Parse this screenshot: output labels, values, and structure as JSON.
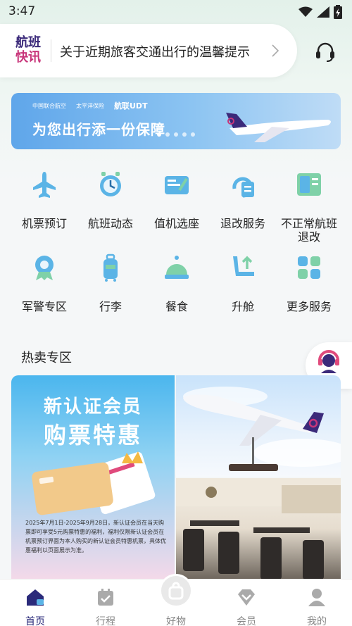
{
  "status_bar": {
    "time": "3:47"
  },
  "notice": {
    "logo_line1": "航班",
    "logo_line2": "快讯",
    "text": "关于近期旅客交通出行的温馨提示"
  },
  "banner": {
    "text": "为您出行添一份保障",
    "logo_a": "中国联合航空",
    "logo_b": "太平洋保险",
    "logo_c": "航联UDT",
    "slide_count": 5,
    "active_slide": 1
  },
  "services": [
    {
      "label": "机票预订",
      "icon": "plane-icon"
    },
    {
      "label": "航班动态",
      "icon": "flight-status-icon"
    },
    {
      "label": "值机选座",
      "icon": "checkin-seat-icon"
    },
    {
      "label": "退改服务",
      "icon": "refund-change-icon"
    },
    {
      "label": "不正常航班\n退改",
      "icon": "irregular-flight-icon"
    },
    {
      "label": "军警专区",
      "icon": "military-badge-icon"
    },
    {
      "label": "行李",
      "icon": "luggage-icon"
    },
    {
      "label": "餐食",
      "icon": "meal-icon"
    },
    {
      "label": "升舱",
      "icon": "upgrade-icon"
    },
    {
      "label": "更多服务",
      "icon": "more-services-icon"
    }
  ],
  "hot_section": {
    "title": "热卖专区",
    "promo_title1": "新认证会员",
    "promo_title2": "购票特惠",
    "promo_fine": "2025年7月1日-2025年9月28日，新认证会员在当天购票即可享受5元购票特惠的福利，福利仅限新认证会员在机票预订界面为本人购买的新认证会员特惠机票，具体优惠福利以页面展示为准。"
  },
  "kefu_label": "客服",
  "tabs": [
    {
      "label": "首页",
      "icon": "home-icon",
      "active": true
    },
    {
      "label": "行程",
      "icon": "itinerary-icon",
      "active": false
    },
    {
      "label": "好物",
      "icon": "shop-icon",
      "active": false
    },
    {
      "label": "会员",
      "icon": "member-diamond-icon",
      "active": false
    },
    {
      "label": "我的",
      "icon": "profile-icon",
      "active": false
    }
  ],
  "colors": {
    "accent": "#2a2a7a",
    "brand_pink": "#c8357a",
    "icon_blue": "#5bb4e6"
  }
}
